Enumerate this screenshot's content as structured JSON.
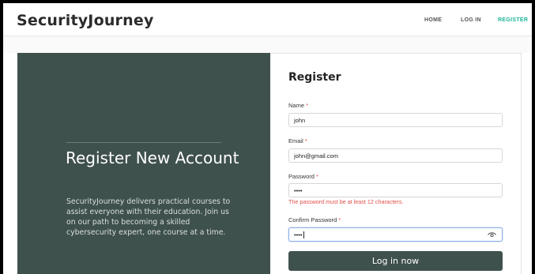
{
  "brand": "SecurityJourney",
  "nav": {
    "home": "HOME",
    "login": "LOG IN",
    "register": "REGISTER"
  },
  "left": {
    "title": "Register New Account",
    "description": "SecurityJourney delivers practical courses to assist everyone with their education. Join us on our path to becoming a skilled cybersecurity expert, one course at a time."
  },
  "form": {
    "title": "Register",
    "required_mark": "*",
    "name": {
      "label": "Name",
      "value": "john"
    },
    "email": {
      "label": "Email",
      "value": "john@gmail.com"
    },
    "password": {
      "label": "Password",
      "value": "••••",
      "error": "The password must be at least 12 characters."
    },
    "confirm": {
      "label": "Confirm Password",
      "value": "••••"
    },
    "submit_label": "Log in now"
  },
  "colors": {
    "accent": "#1fb59a",
    "panel": "#3f514d",
    "error": "#e0504b"
  },
  "icons": {
    "toggle_visibility": "eye-icon"
  }
}
